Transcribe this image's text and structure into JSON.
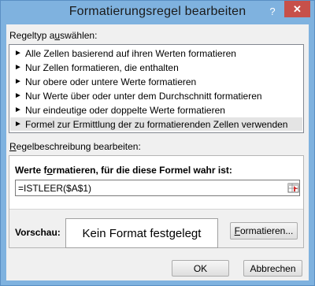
{
  "window": {
    "title": "Formatierungsregel bearbeiten",
    "help": "?",
    "close": "✕"
  },
  "rule_type": {
    "label_pre": "Regeltyp a",
    "label_ul": "u",
    "label_post": "swählen:",
    "items": [
      "Alle Zellen basierend auf ihren Werten formatieren",
      "Nur Zellen formatieren, die enthalten",
      "Nur obere oder untere Werte formatieren",
      "Nur Werte über oder unter dem Durchschnitt formatieren",
      "Nur eindeutige oder doppelte Werte formatieren",
      "Formel zur Ermittlung der zu formatierenden Zellen verwenden"
    ],
    "selected_index": 5,
    "arrow": "►"
  },
  "description": {
    "label_pre": "",
    "label_ul": "R",
    "label_post": "egelbeschreibung bearbeiten:",
    "formula_label_pre": "Werte f",
    "formula_label_ul": "o",
    "formula_label_post": "rmatieren, für die diese Formel wahr ist:",
    "formula_value": "=ISTLEER($A$1)",
    "preview_label": "Vorschau:",
    "preview_text": "Kein Format festgelegt",
    "format_button_pre": "",
    "format_button_ul": "F",
    "format_button_post": "ormatieren..."
  },
  "buttons": {
    "ok": "OK",
    "cancel": "Abbrechen"
  }
}
